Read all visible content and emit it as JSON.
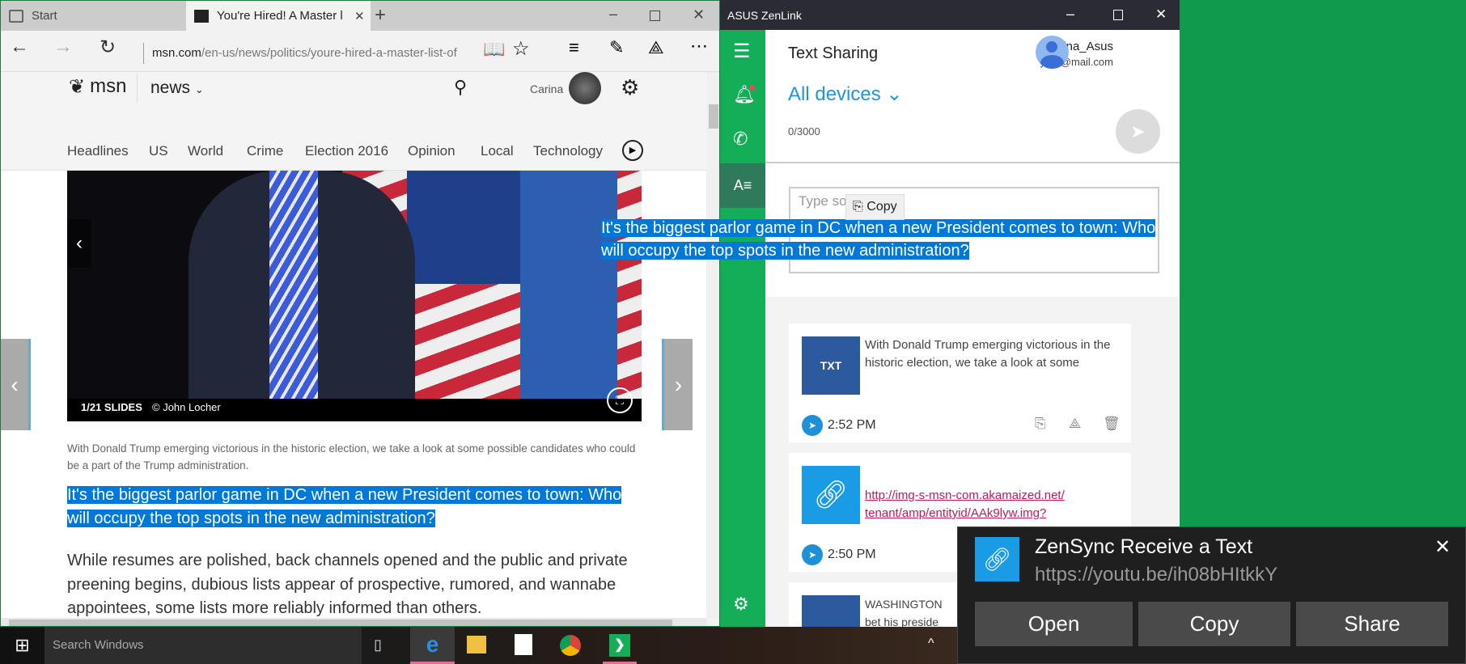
{
  "browser": {
    "tabs": [
      {
        "label": "Start"
      },
      {
        "label": "You're Hired! A Master l"
      }
    ],
    "new_tab": "+",
    "url_domain": "msn.com",
    "url_path": "/en-us/news/politics/youre-hired-a-master-list-of",
    "msn": {
      "logo": "msn",
      "section": "news",
      "user": "Carina"
    },
    "nav": [
      "Headlines",
      "US",
      "World",
      "Crime",
      "Election 2016",
      "Opinion",
      "Local",
      "Technology"
    ],
    "slide_counter": "1/21 SLIDES",
    "photo_credit": "© John Locher",
    "caption": "With Donald Trump emerging victorious in the historic election, we take a look at some possible candidates who could be a part of the Trump administration.",
    "highlight_line1": "It's the biggest parlor game in DC when a new President comes to town: Who",
    "highlight_line2": "will occupy the top spots in the new administration?",
    "body": "While resumes are polished, back channels opened and the public and private preening begins, dubious lists appear of prospective, rumored, and wannabe appointees, some lists more reliably informed than others."
  },
  "zenlink": {
    "title": "ASUS ZenLink",
    "page_title": "Text Sharing",
    "user_name": "Carina_Asus",
    "user_email": "your@mail.com",
    "device_selector": "All devices",
    "char_count": "0/3000",
    "input_placeholder": "Type so",
    "copy_tooltip": "Copy",
    "drag_line1": "It's the biggest parlor game in DC when a new President comes to town: Who",
    "drag_line2": "will occupy the top spots in the new administration?",
    "items": [
      {
        "type": "TXT",
        "text": "With Donald Trump emerging victorious in the historic election, we take a look at some",
        "time": "2:52 PM"
      },
      {
        "type": "link",
        "text": "http://img-s-msn-com.akamaized.net/ tenant/amp/entityid/AAk9lyw.img?",
        "time": "2:50 PM"
      },
      {
        "type": "TXT",
        "text": "WASHINGTON bet his preside"
      }
    ]
  },
  "taskbar": {
    "search_placeholder": "Search Windows"
  },
  "notification": {
    "title": "ZenSync Receive a Text",
    "url": "https://youtu.be/ih08bHItkkY",
    "buttons": [
      "Open",
      "Copy",
      "Share"
    ]
  },
  "colors": {
    "desktop": "#0f9a4e",
    "zen_green": "#13ae57",
    "selection": "#0078d7",
    "accent": "#1e90d8"
  }
}
